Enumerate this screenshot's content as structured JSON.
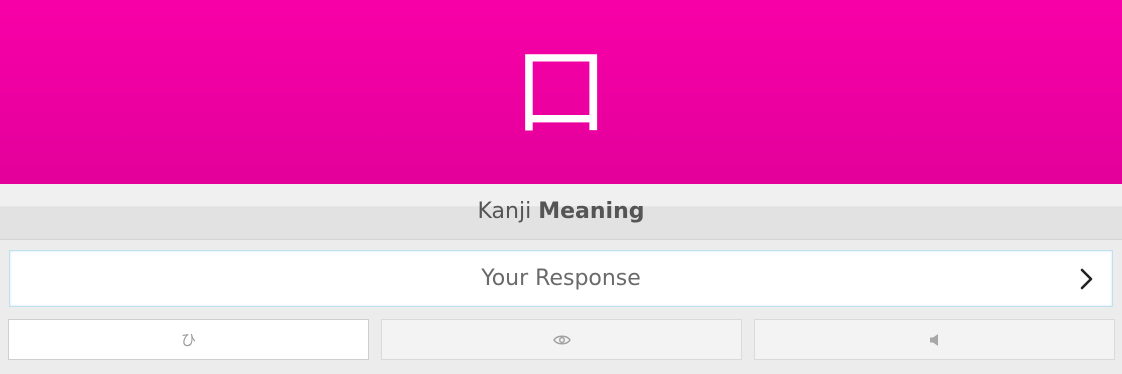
{
  "character": {
    "glyph": "口"
  },
  "question": {
    "type": "Kanji",
    "category": "Meaning"
  },
  "answer": {
    "value": "",
    "placeholder": "Your Response"
  },
  "actions": {
    "kana_label": "ひ",
    "info_icon": "eye-icon",
    "audio_icon": "speaker-icon"
  },
  "colors": {
    "character_bg": "#f800a8",
    "question_text": "#555555",
    "input_border": "#bfe0ee"
  }
}
